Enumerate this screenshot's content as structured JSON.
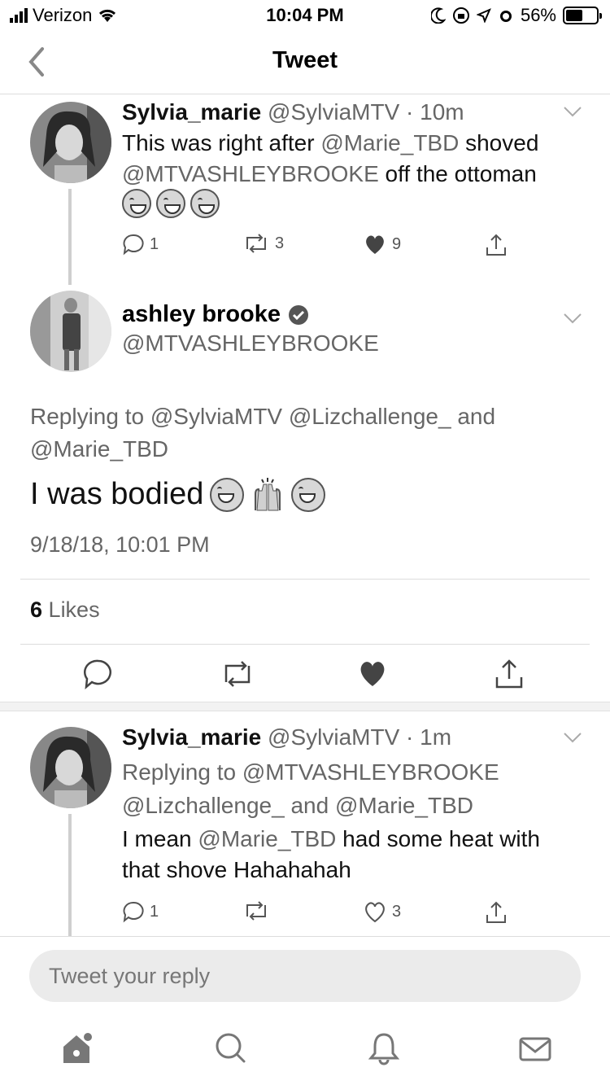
{
  "status_bar": {
    "carrier": "Verizon",
    "time": "10:04 PM",
    "battery_percent": "56%",
    "battery_level": 0.56
  },
  "nav": {
    "title": "Tweet"
  },
  "tweets": [
    {
      "name": "Sylvia_marie",
      "handle": "@SylviaMTV",
      "time": "10m",
      "text_prefix": "This was right after ",
      "mention_1": "@Marie_TBD",
      "text_mid": " shoved",
      "mention_2": "@MTVASHLEYBROOKE",
      "text_suffix": " off the ottoman",
      "reply_count": "1",
      "retweet_count": "3",
      "like_count": "9"
    },
    {
      "name": "Sylvia_marie",
      "handle": "@SylviaMTV",
      "time": "1m",
      "replying_label": "Replying to",
      "replying_1": "@MTVASHLEYBROOKE",
      "replying_2": "@Lizchallenge_",
      "replying_and": "and",
      "replying_3": "@Marie_TBD",
      "text_prefix": "I mean ",
      "mention_1": "@Marie_TBD",
      "text_suffix_1": " had some heat with",
      "text_line_2": "that shove Hahahahah",
      "reply_count": "1",
      "like_count": "3"
    }
  ],
  "main_tweet": {
    "name": "ashley brooke",
    "handle": "@MTVASHLEYBROOKE",
    "replying_label": "Replying to",
    "replying_1": "@SylviaMTV",
    "replying_2": "@Lizchallenge_",
    "replying_and": "and",
    "replying_3": "@Marie_TBD",
    "text": "I was bodied",
    "timestamp": "9/18/18, 10:01 PM",
    "likes_count": "6",
    "likes_label": "Likes"
  },
  "composer": {
    "placeholder": "Tweet your reply"
  },
  "icons": {
    "tab_home": "home-icon",
    "tab_search": "search-icon",
    "tab_notifications": "bell-icon",
    "tab_messages": "mail-icon"
  }
}
